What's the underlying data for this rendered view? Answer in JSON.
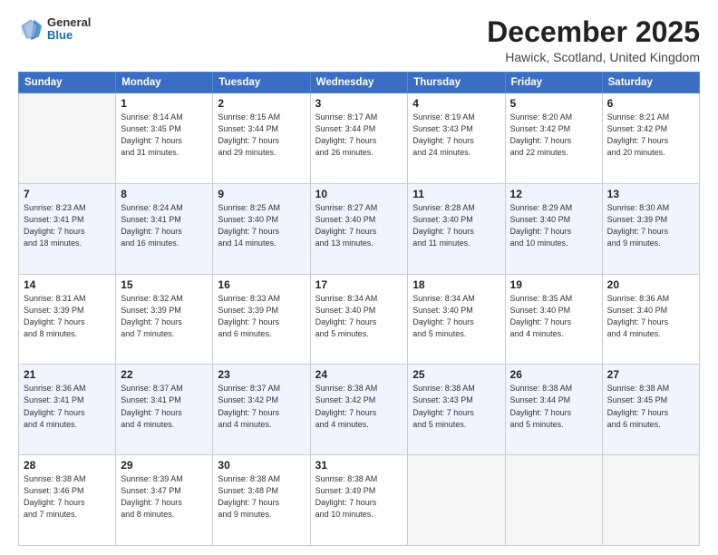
{
  "header": {
    "logo_general": "General",
    "logo_blue": "Blue",
    "month_title": "December 2025",
    "location": "Hawick, Scotland, United Kingdom"
  },
  "days_of_week": [
    "Sunday",
    "Monday",
    "Tuesday",
    "Wednesday",
    "Thursday",
    "Friday",
    "Saturday"
  ],
  "weeks": [
    [
      {
        "day": "",
        "info": ""
      },
      {
        "day": "1",
        "info": "Sunrise: 8:14 AM\nSunset: 3:45 PM\nDaylight: 7 hours\nand 31 minutes."
      },
      {
        "day": "2",
        "info": "Sunrise: 8:15 AM\nSunset: 3:44 PM\nDaylight: 7 hours\nand 29 minutes."
      },
      {
        "day": "3",
        "info": "Sunrise: 8:17 AM\nSunset: 3:44 PM\nDaylight: 7 hours\nand 26 minutes."
      },
      {
        "day": "4",
        "info": "Sunrise: 8:19 AM\nSunset: 3:43 PM\nDaylight: 7 hours\nand 24 minutes."
      },
      {
        "day": "5",
        "info": "Sunrise: 8:20 AM\nSunset: 3:42 PM\nDaylight: 7 hours\nand 22 minutes."
      },
      {
        "day": "6",
        "info": "Sunrise: 8:21 AM\nSunset: 3:42 PM\nDaylight: 7 hours\nand 20 minutes."
      }
    ],
    [
      {
        "day": "7",
        "info": "Sunrise: 8:23 AM\nSunset: 3:41 PM\nDaylight: 7 hours\nand 18 minutes."
      },
      {
        "day": "8",
        "info": "Sunrise: 8:24 AM\nSunset: 3:41 PM\nDaylight: 7 hours\nand 16 minutes."
      },
      {
        "day": "9",
        "info": "Sunrise: 8:25 AM\nSunset: 3:40 PM\nDaylight: 7 hours\nand 14 minutes."
      },
      {
        "day": "10",
        "info": "Sunrise: 8:27 AM\nSunset: 3:40 PM\nDaylight: 7 hours\nand 13 minutes."
      },
      {
        "day": "11",
        "info": "Sunrise: 8:28 AM\nSunset: 3:40 PM\nDaylight: 7 hours\nand 11 minutes."
      },
      {
        "day": "12",
        "info": "Sunrise: 8:29 AM\nSunset: 3:40 PM\nDaylight: 7 hours\nand 10 minutes."
      },
      {
        "day": "13",
        "info": "Sunrise: 8:30 AM\nSunset: 3:39 PM\nDaylight: 7 hours\nand 9 minutes."
      }
    ],
    [
      {
        "day": "14",
        "info": "Sunrise: 8:31 AM\nSunset: 3:39 PM\nDaylight: 7 hours\nand 8 minutes."
      },
      {
        "day": "15",
        "info": "Sunrise: 8:32 AM\nSunset: 3:39 PM\nDaylight: 7 hours\nand 7 minutes."
      },
      {
        "day": "16",
        "info": "Sunrise: 8:33 AM\nSunset: 3:39 PM\nDaylight: 7 hours\nand 6 minutes."
      },
      {
        "day": "17",
        "info": "Sunrise: 8:34 AM\nSunset: 3:40 PM\nDaylight: 7 hours\nand 5 minutes."
      },
      {
        "day": "18",
        "info": "Sunrise: 8:34 AM\nSunset: 3:40 PM\nDaylight: 7 hours\nand 5 minutes."
      },
      {
        "day": "19",
        "info": "Sunrise: 8:35 AM\nSunset: 3:40 PM\nDaylight: 7 hours\nand 4 minutes."
      },
      {
        "day": "20",
        "info": "Sunrise: 8:36 AM\nSunset: 3:40 PM\nDaylight: 7 hours\nand 4 minutes."
      }
    ],
    [
      {
        "day": "21",
        "info": "Sunrise: 8:36 AM\nSunset: 3:41 PM\nDaylight: 7 hours\nand 4 minutes."
      },
      {
        "day": "22",
        "info": "Sunrise: 8:37 AM\nSunset: 3:41 PM\nDaylight: 7 hours\nand 4 minutes."
      },
      {
        "day": "23",
        "info": "Sunrise: 8:37 AM\nSunset: 3:42 PM\nDaylight: 7 hours\nand 4 minutes."
      },
      {
        "day": "24",
        "info": "Sunrise: 8:38 AM\nSunset: 3:42 PM\nDaylight: 7 hours\nand 4 minutes."
      },
      {
        "day": "25",
        "info": "Sunrise: 8:38 AM\nSunset: 3:43 PM\nDaylight: 7 hours\nand 5 minutes."
      },
      {
        "day": "26",
        "info": "Sunrise: 8:38 AM\nSunset: 3:44 PM\nDaylight: 7 hours\nand 5 minutes."
      },
      {
        "day": "27",
        "info": "Sunrise: 8:38 AM\nSunset: 3:45 PM\nDaylight: 7 hours\nand 6 minutes."
      }
    ],
    [
      {
        "day": "28",
        "info": "Sunrise: 8:38 AM\nSunset: 3:46 PM\nDaylight: 7 hours\nand 7 minutes."
      },
      {
        "day": "29",
        "info": "Sunrise: 8:39 AM\nSunset: 3:47 PM\nDaylight: 7 hours\nand 8 minutes."
      },
      {
        "day": "30",
        "info": "Sunrise: 8:38 AM\nSunset: 3:48 PM\nDaylight: 7 hours\nand 9 minutes."
      },
      {
        "day": "31",
        "info": "Sunrise: 8:38 AM\nSunset: 3:49 PM\nDaylight: 7 hours\nand 10 minutes."
      },
      {
        "day": "",
        "info": ""
      },
      {
        "day": "",
        "info": ""
      },
      {
        "day": "",
        "info": ""
      }
    ]
  ]
}
